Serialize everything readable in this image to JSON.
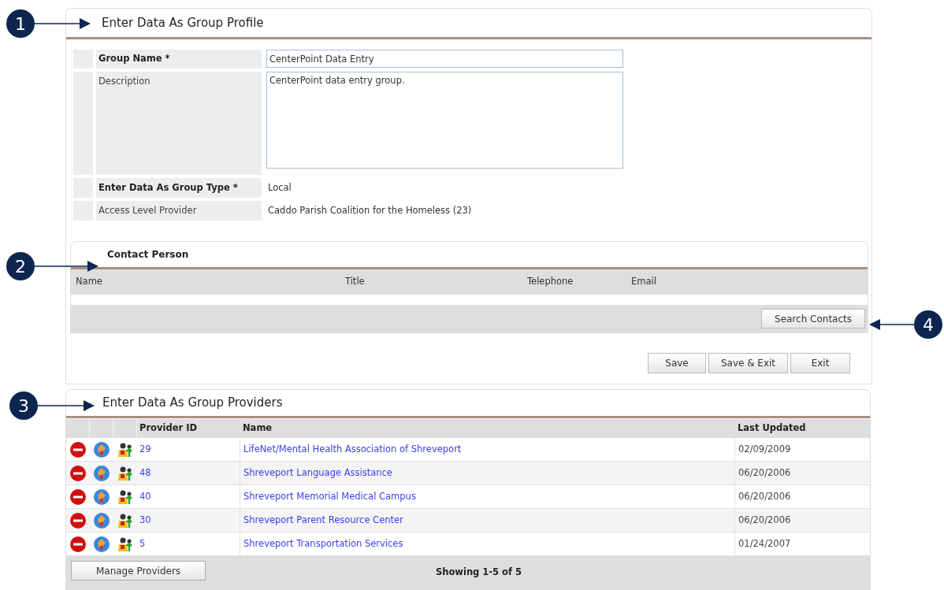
{
  "callouts": [
    {
      "number": "1"
    },
    {
      "number": "2"
    },
    {
      "number": "3"
    },
    {
      "number": "4"
    }
  ],
  "profile": {
    "title": "Enter Data As Group Profile",
    "fields": [
      {
        "label": "Group Name *",
        "required": true,
        "kind": "input",
        "value": "CenterPoint Data Entry"
      },
      {
        "label": "Description",
        "required": false,
        "kind": "textarea",
        "value": "CenterPoint data entry group."
      },
      {
        "label": "Enter Data As Group Type *",
        "required": true,
        "kind": "text",
        "value": "Local"
      },
      {
        "label": "Access Level Provider",
        "required": false,
        "kind": "text",
        "value": "Caddo Parish Coalition for the Homeless (23)"
      }
    ],
    "contact": {
      "title": "Contact Person",
      "columns": [
        "Name",
        "Title",
        "Telephone",
        "Email"
      ],
      "search_button": "Search Contacts"
    },
    "buttons": [
      "Save",
      "Save & Exit",
      "Exit"
    ]
  },
  "providers": {
    "title": "Enter Data As Group Providers",
    "columns": [
      "Provider ID",
      "Name",
      "Last Updated"
    ],
    "rows": [
      {
        "id": "29",
        "name": "LifeNet/Mental Health Association of Shreveport",
        "updated": "02/09/2009"
      },
      {
        "id": "48",
        "name": "Shreveport Language Assistance",
        "updated": "06/20/2006"
      },
      {
        "id": "40",
        "name": "Shreveport Memorial Medical Campus",
        "updated": "06/20/2006"
      },
      {
        "id": "30",
        "name": "Shreveport Parent Resource Center",
        "updated": "06/20/2006"
      },
      {
        "id": "5",
        "name": "Shreveport Transportation Services",
        "updated": "01/24/2007"
      }
    ],
    "manage_button": "Manage Providers",
    "showing": "Showing 1-5 of 5"
  }
}
